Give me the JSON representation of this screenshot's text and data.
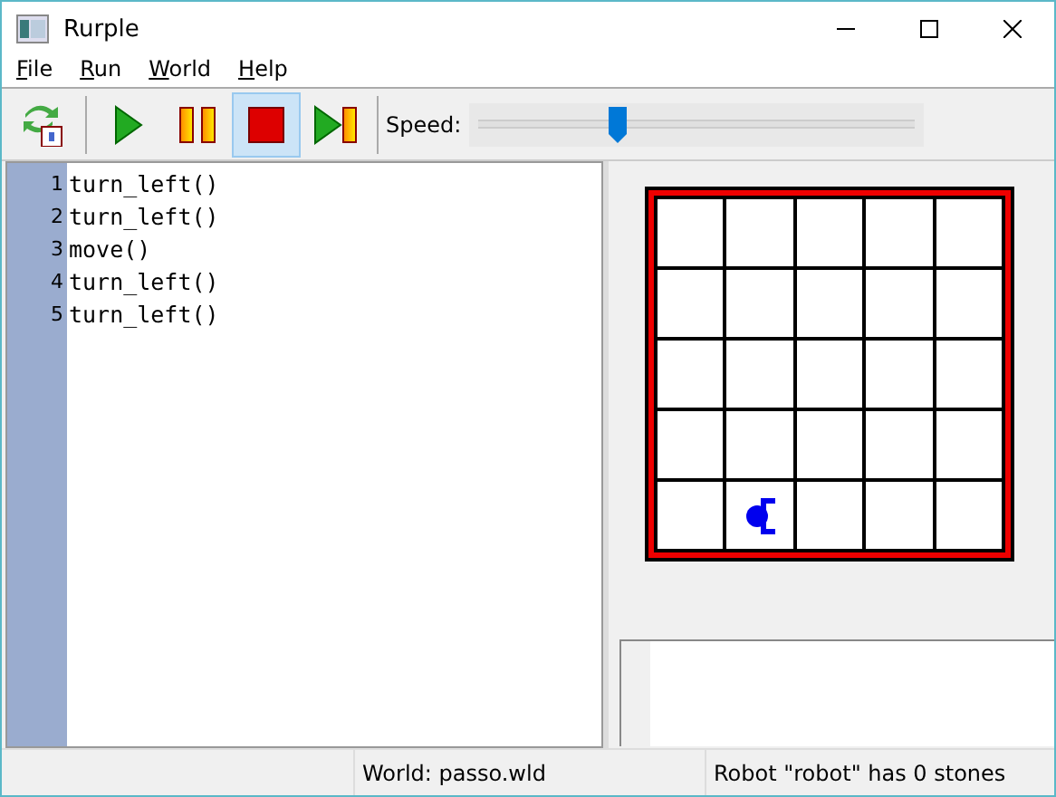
{
  "window": {
    "title": "Rurple"
  },
  "menu": [
    {
      "label": "File"
    },
    {
      "label": "Run"
    },
    {
      "label": "World"
    },
    {
      "label": "Help"
    }
  ],
  "toolbar": {
    "buttons": [
      {
        "kind": "reload",
        "selected": false
      },
      {
        "kind": "play",
        "selected": false
      },
      {
        "kind": "pause",
        "selected": false
      },
      {
        "kind": "stop",
        "selected": true
      },
      {
        "kind": "step",
        "selected": false
      }
    ],
    "speed": {
      "label": "Speed:",
      "level": 0.32
    }
  },
  "editor": {
    "lines": [
      {
        "number": "1",
        "code": "turn_left()"
      },
      {
        "number": "2",
        "code": "turn_left()"
      },
      {
        "number": "3",
        "code": "move()"
      },
      {
        "number": "4",
        "code": "turn_left()"
      },
      {
        "number": "5",
        "code": "turn_left()"
      }
    ]
  },
  "world": {
    "rows": [
      [
        {
          "robot": false
        },
        {
          "robot": false
        },
        {
          "robot": false
        },
        {
          "robot": false
        },
        {
          "robot": false
        }
      ],
      [
        {
          "robot": false
        },
        {
          "robot": false
        },
        {
          "robot": false
        },
        {
          "robot": false
        },
        {
          "robot": false
        }
      ],
      [
        {
          "robot": false
        },
        {
          "robot": false
        },
        {
          "robot": false
        },
        {
          "robot": false
        },
        {
          "robot": false
        }
      ],
      [
        {
          "robot": false
        },
        {
          "robot": false
        },
        {
          "robot": false
        },
        {
          "robot": false
        },
        {
          "robot": false
        }
      ],
      [
        {
          "robot": false
        },
        {
          "robot": true
        },
        {
          "robot": false
        },
        {
          "robot": false
        },
        {
          "robot": false
        }
      ]
    ]
  },
  "status_bar": [
    "World: passo.wld",
    "Robot \"robot\" has 0 stones"
  ]
}
